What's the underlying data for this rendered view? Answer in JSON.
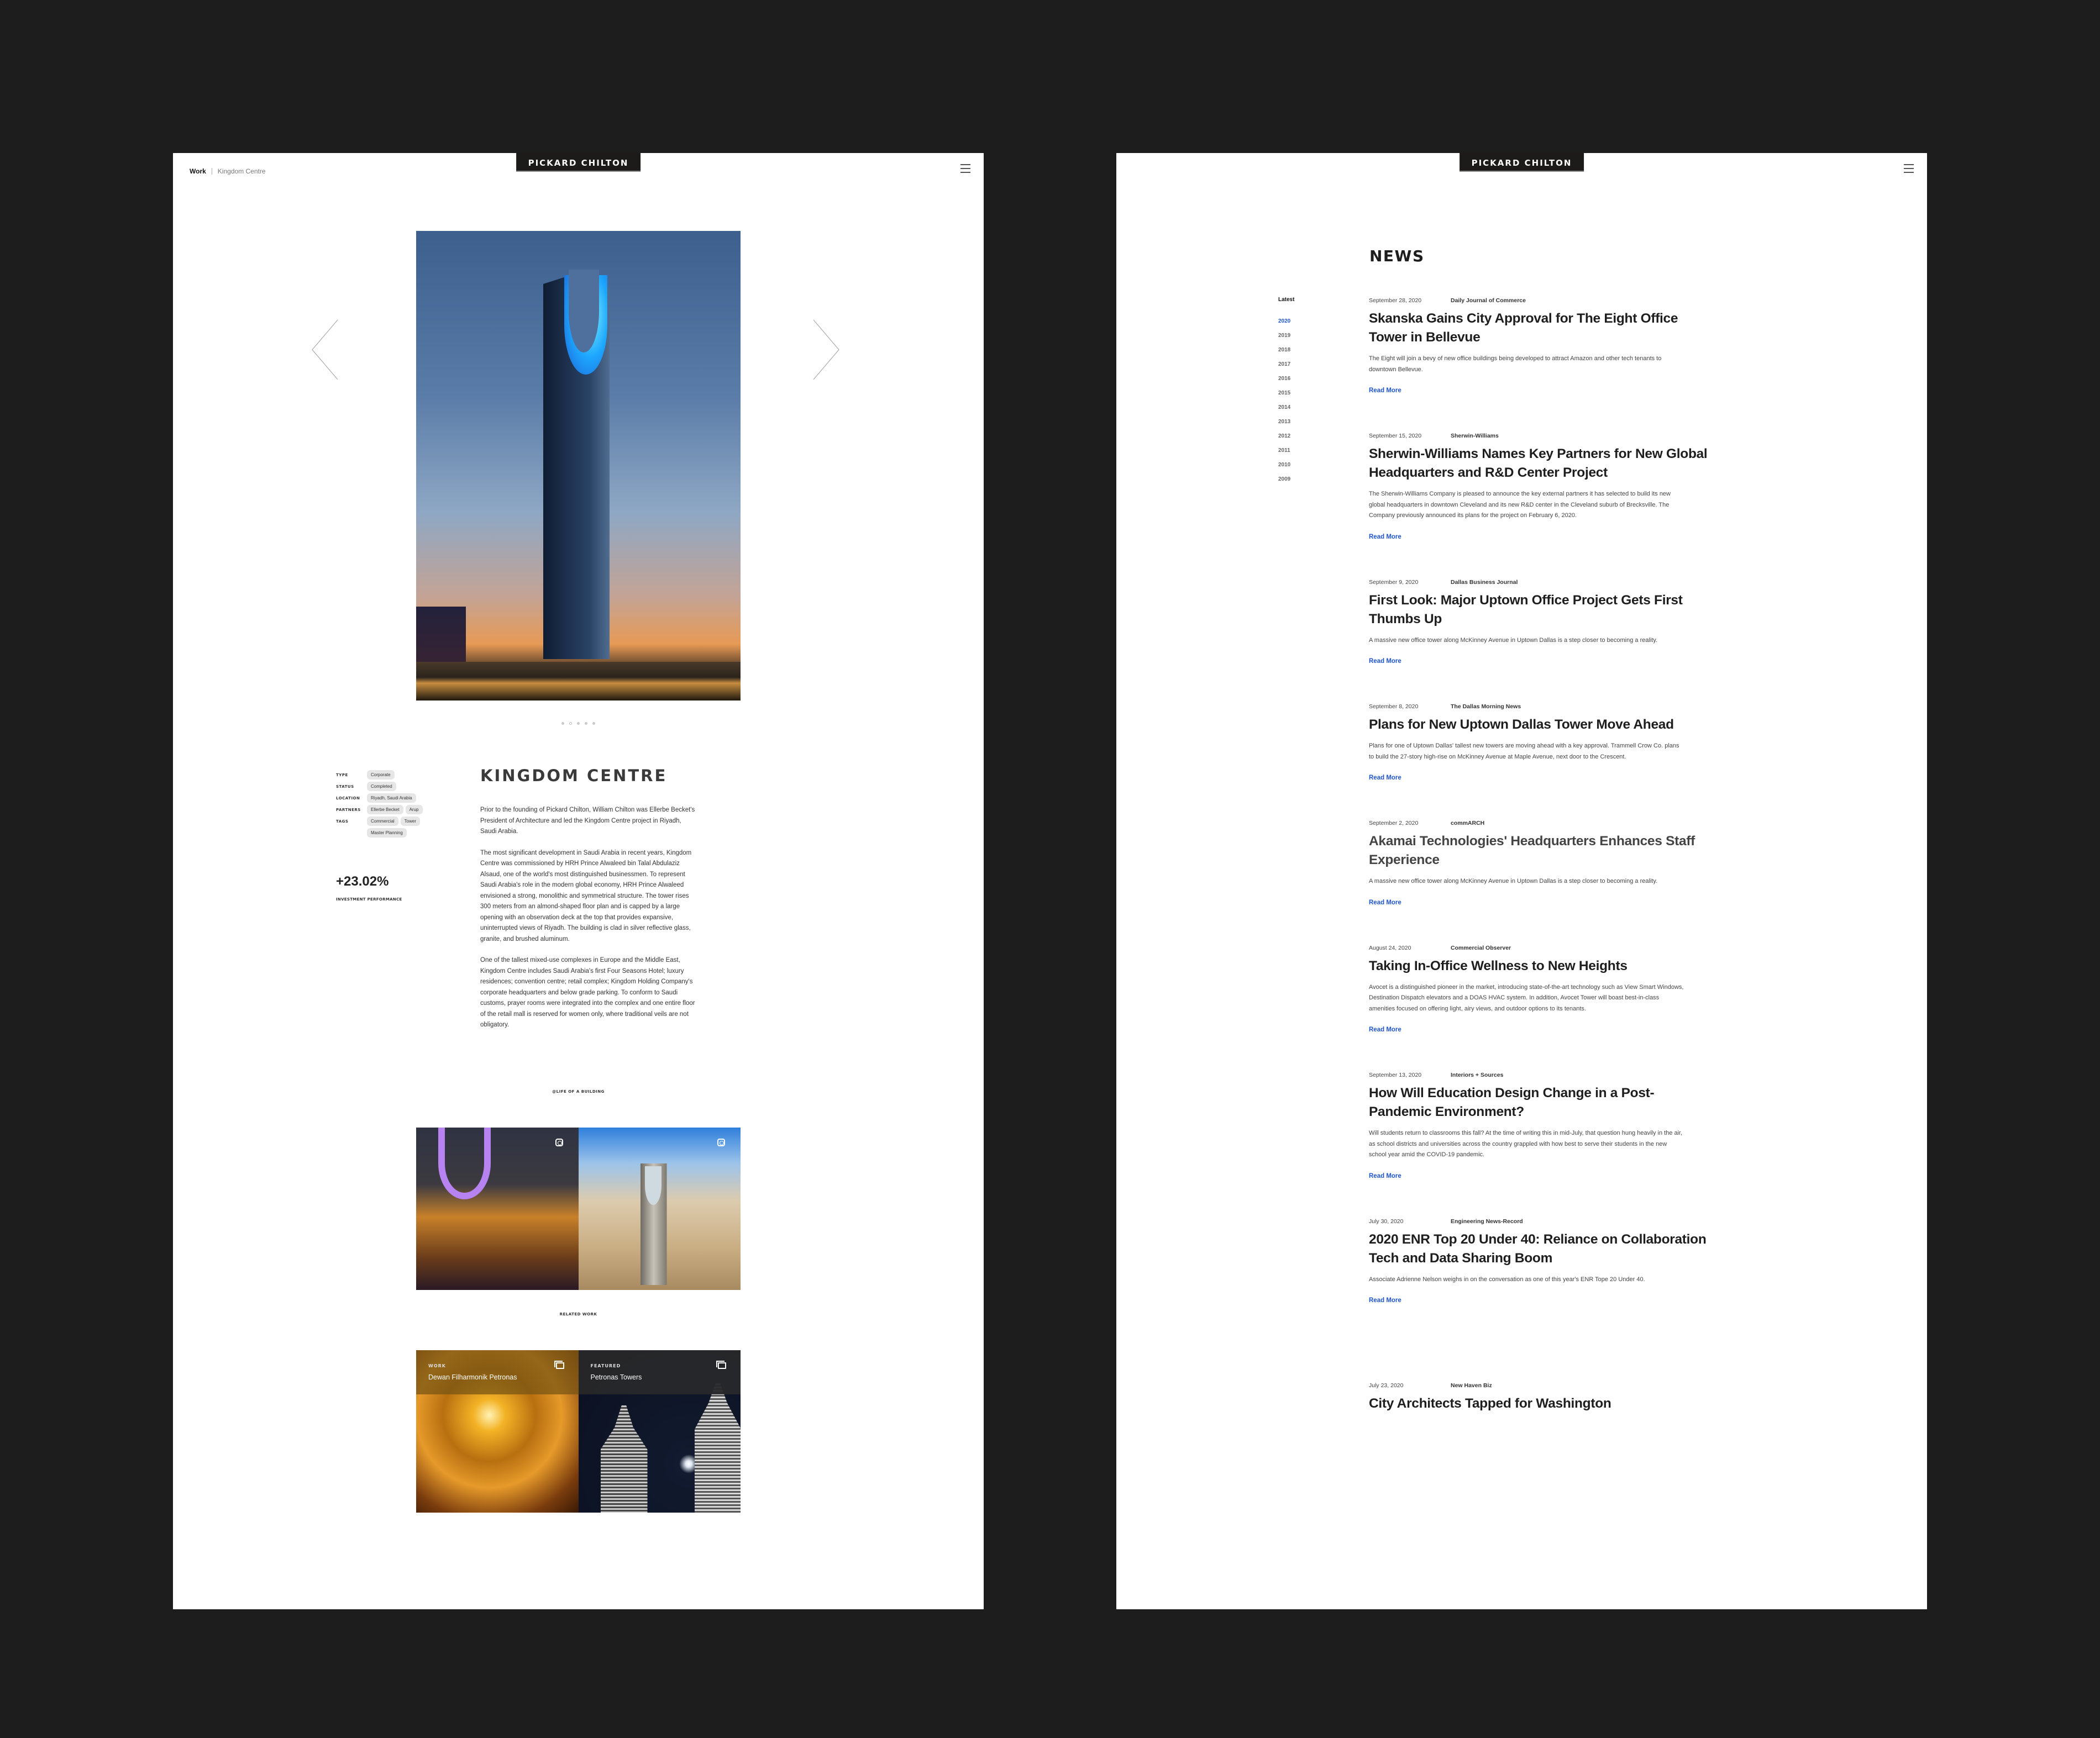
{
  "brand": {
    "logo_text": "PICKARD CHILTON"
  },
  "project_page": {
    "breadcrumb": {
      "section": "Work",
      "current": "Kingdom Centre"
    },
    "carousel": {
      "slide_count": 5,
      "active_index": 1
    },
    "meta": [
      {
        "label": "TYPE",
        "tags": [
          "Corporate"
        ]
      },
      {
        "label": "STATUS",
        "tags": [
          "Completed"
        ]
      },
      {
        "label": "LOCATION",
        "tags": [
          "Riyadh, Saudi Arabia"
        ]
      },
      {
        "label": "PARTNERS",
        "tags": [
          "Ellerbe Becket",
          "Arup"
        ]
      },
      {
        "label": "TAGS",
        "tags": [
          "Commercial",
          "Tower",
          "Master Planning"
        ]
      }
    ],
    "performance": {
      "value": "+23.02%",
      "label": "INVESTMENT PERFORMANCE"
    },
    "title": "KINGDOM CENTRE",
    "body": [
      "Prior to the founding of Pickard Chilton, William Chilton was Ellerbe Becket's President of Architecture and led the Kingdom Centre project in Riyadh, Saudi Arabia.",
      "The most significant development in Saudi Arabia in recent years, Kingdom Centre was commissioned by HRH Prince Alwaleed bin Talal Abdulaziz Alsaud, one of the world's most distinguished businessmen. To represent Saudi Arabia's role in the modern global economy, HRH Prince Alwaleed envisioned a strong, monolithic and symmetrical structure. The tower rises 300 meters from an almond-shaped floor plan and is capped by a large opening with an observation deck at the top that provides expansive, uninterrupted views of Riyadh. The building is clad in silver reflective glass, granite, and brushed aluminum.",
      "One of the tallest mixed-use complexes in Europe and the Middle East, Kingdom Centre includes Saudi Arabia's first Four Seasons Hotel; luxury residences; convention centre; retail complex; Kingdom Holding Company's corporate headquarters and below grade parking. To conform to Saudi customs, prayer rooms were integrated into the complex and one entire floor of the retail mall is reserved for women only, where traditional veils are not obligatory."
    ],
    "instagram_label": "@LIFE OF A BUILDING",
    "related_label": "RELATED WORK",
    "related": [
      {
        "category": "WORK",
        "title": "Dewan Filharmonik Petronas"
      },
      {
        "category": "FEATURED",
        "title": "Petronas Towers"
      }
    ]
  },
  "news_page": {
    "title": "NEWS",
    "filter": {
      "latest_label": "Latest",
      "active_year": "2020",
      "years": [
        "2020",
        "2019",
        "2018",
        "2017",
        "2016",
        "2015",
        "2014",
        "2013",
        "2012",
        "2011",
        "2010",
        "2009"
      ]
    },
    "read_more_label": "Read More",
    "items": [
      {
        "date": "September 28, 2020",
        "source": "Daily Journal of Commerce",
        "headline": "Skanska Gains City Approval for The Eight Office Tower in Bellevue",
        "summary": "The Eight will join a bevy of new office buildings being developed to attract Amazon and other tech tenants to downtown Bellevue."
      },
      {
        "date": "September 15, 2020",
        "source": "Sherwin-Williams",
        "headline": "Sherwin-Williams Names Key Partners for New Global Headquarters and R&D Center Project",
        "summary": "The Sherwin-Williams Company is pleased to announce the key external partners it has selected to build its new global headquarters in downtown Cleveland and its new R&D center in the Cleveland suburb of Brecksville. The Company previously announced its plans for the project on February 6, 2020."
      },
      {
        "date": "September 9, 2020",
        "source": "Dallas Business Journal",
        "headline": "First Look: Major Uptown Office Project Gets First Thumbs Up",
        "summary": "A massive new office tower along McKinney Avenue in Uptown Dallas is a step closer to becoming a reality."
      },
      {
        "date": "September 8, 2020",
        "source": "The Dallas Morning News",
        "headline": "Plans for New Uptown Dallas Tower Move Ahead",
        "summary": "Plans for one of Uptown Dallas' tallest new towers are moving ahead with a key approval. Trammell Crow Co. plans to build the 27-story high-rise on McKinney Avenue at Maple Avenue, next door to the Crescent."
      },
      {
        "date": "September 2, 2020",
        "source": "commARCH",
        "headline": "Akamai Technologies' Headquarters Enhances Staff Experience",
        "summary": "A massive new office tower along McKinney Avenue in Uptown Dallas is a step closer to becoming a reality."
      },
      {
        "date": "August 24, 2020",
        "source": "Commercial Observer",
        "headline": "Taking In-Office Wellness to New Heights",
        "summary": "Avocet is a distinguished pioneer in the market, introducing state-of-the-art technology such as View Smart Windows, Destination Dispatch elevators and a DOAS HVAC system. In addition, Avocet Tower will boast best-in-class amenities focused on offering light, airy views, and outdoor options to its tenants."
      },
      {
        "date": "September 13, 2020",
        "source": "Interiors + Sources",
        "headline": "How Will Education Design Change in a Post-Pandemic Environment?",
        "summary": "Will students return to classrooms this fall? At the time of writing this in mid-July, that question hung heavily in the air, as school districts and universities across the country grappled with how best to serve their students in the new school year amid the COVID-19 pandemic."
      },
      {
        "date": "July 30, 2020",
        "source": "Engineering News-Record",
        "headline": "2020 ENR Top 20 Under 40: Reliance on Collaboration Tech and Data Sharing Boom",
        "summary": "Associate Adrienne Nelson weighs in on the conversation as one of this year's ENR Tope 20 Under 40."
      },
      {
        "date": "July 23, 2020",
        "source": "New Haven Biz",
        "headline": "City Architects Tapped for Washington",
        "summary": ""
      }
    ]
  },
  "colors": {
    "background": "#1d1d1d",
    "link_blue": "#1f55c9",
    "logo_bg": "#1d1a1a"
  }
}
